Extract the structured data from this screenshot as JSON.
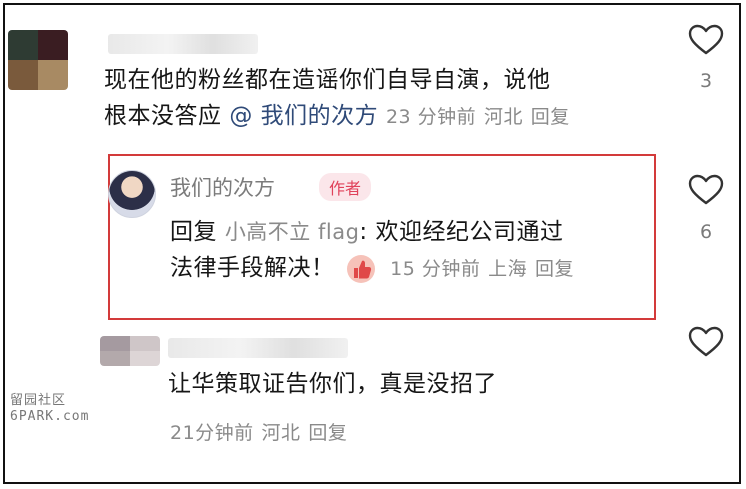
{
  "comments": [
    {
      "text_line1": "现在他的粉丝都在造谣你们自导自演，说他",
      "text_line2": "根本没答应",
      "mention": "@ 我们的次方",
      "time": "23 分钟前",
      "location": "河北",
      "reply_label": "回复",
      "like_count": "3"
    },
    {
      "author": "我们的次方",
      "author_badge": "作者",
      "reply_prefix": "回复",
      "reply_to": "小高不立 flag",
      "text_line1": ": 欢迎经纪公司通过",
      "text_line2": "法律手段解决！",
      "time": "15 分钟前",
      "location": "上海",
      "reply_label": "回复",
      "like_count": "6"
    },
    {
      "text": "让华策取证告你们，真是没招了",
      "time": "21分钟前",
      "location": "河北",
      "reply_label": "回复",
      "like_count": ""
    }
  ],
  "watermark": {
    "line1": "留园社区",
    "line2": "6PARK.com"
  },
  "colors": {
    "highlight_border": "#d33a3a",
    "mention": "#2f4a78",
    "badge_text": "#e0425b",
    "badge_bg": "#fbe6ea",
    "meta": "#8a8a8a"
  },
  "icons": [
    "heart-outline-icon",
    "thumbs-up-icon"
  ]
}
